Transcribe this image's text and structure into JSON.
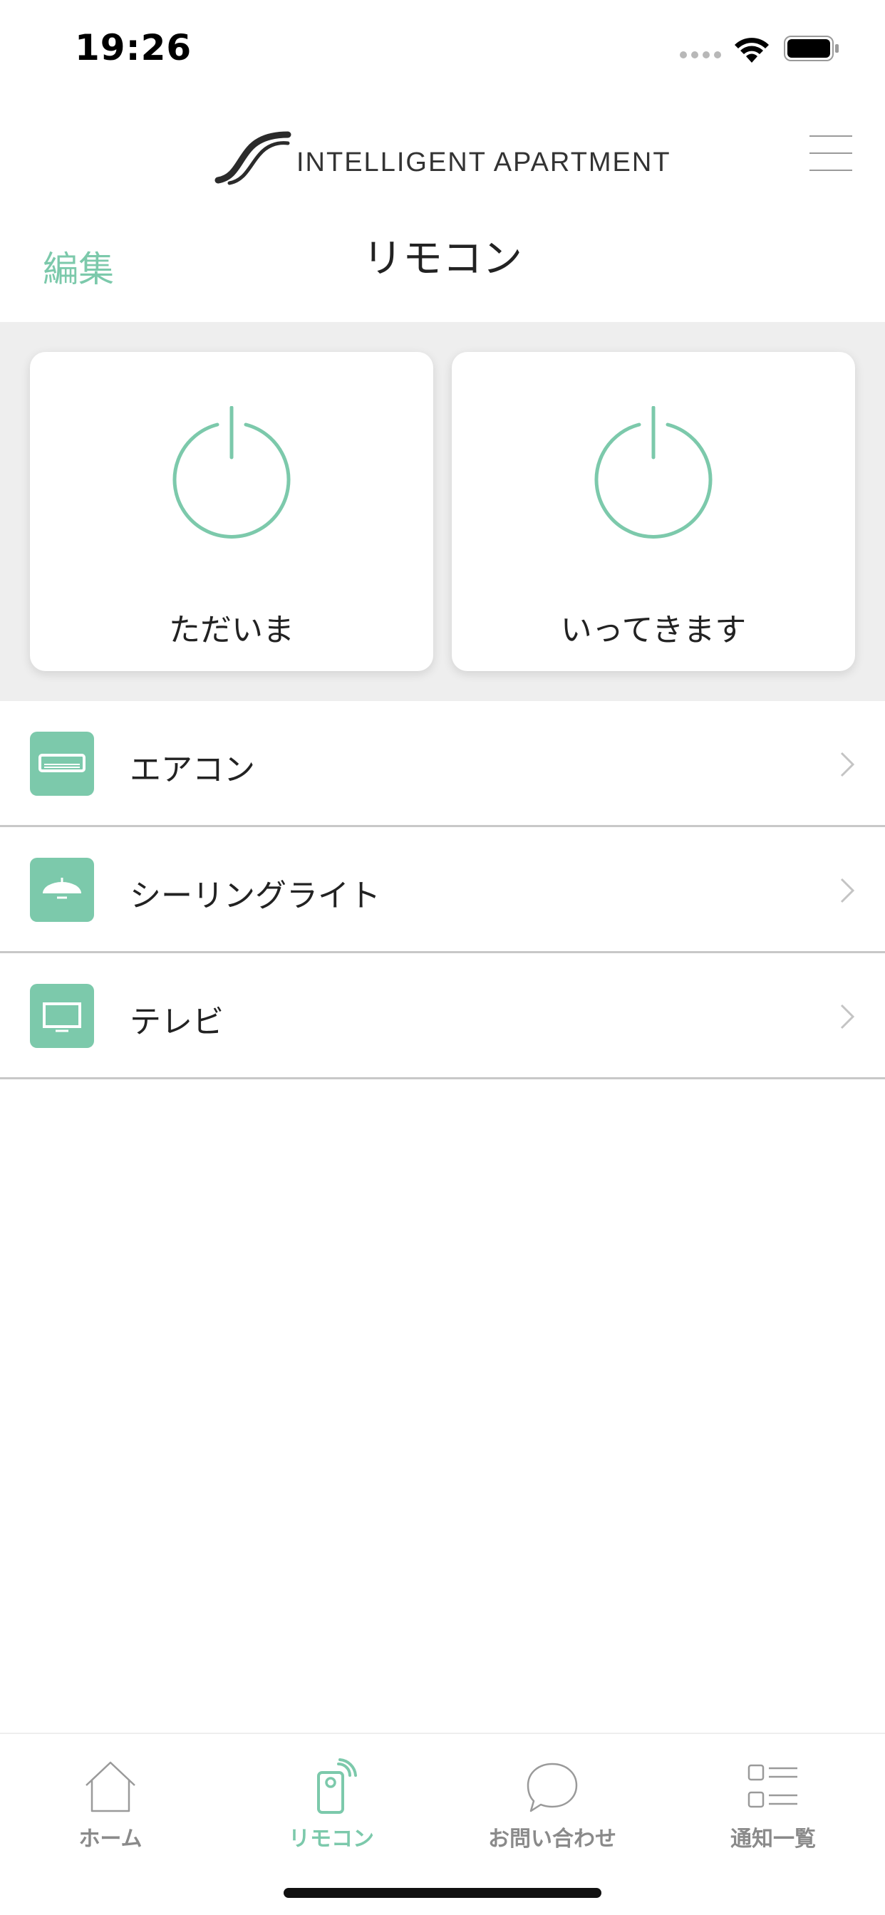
{
  "status_bar": {
    "time": "19:26"
  },
  "header": {
    "logo_text": "INTELLIGENT APARTMENT"
  },
  "toolbar": {
    "edit_label": "編集",
    "title": "リモコン"
  },
  "scenes": [
    {
      "label": "ただいま",
      "icon": "power-icon"
    },
    {
      "label": "いってきます",
      "icon": "power-icon"
    }
  ],
  "devices": [
    {
      "label": "エアコン",
      "icon": "air-conditioner-icon"
    },
    {
      "label": "シーリングライト",
      "icon": "ceiling-light-icon"
    },
    {
      "label": "テレビ",
      "icon": "tv-icon"
    }
  ],
  "tabs": [
    {
      "label": "ホーム",
      "icon": "home-icon",
      "active": false
    },
    {
      "label": "リモコン",
      "icon": "remote-icon",
      "active": true
    },
    {
      "label": "お問い合わせ",
      "icon": "chat-bubble-icon",
      "active": false
    },
    {
      "label": "通知一覧",
      "icon": "notification-list-icon",
      "active": false
    }
  ],
  "colors": {
    "accent": "#7cc9ab",
    "scene_background": "#eeeeee",
    "inactive_tab": "#8a8a8a"
  }
}
